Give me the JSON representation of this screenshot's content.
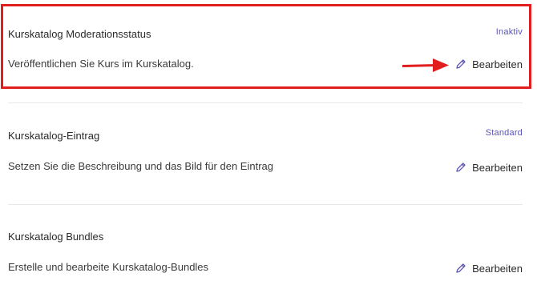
{
  "sections": [
    {
      "title": "Kurskatalog Moderationsstatus",
      "status": "Inaktiv",
      "description": "Veröffentlichen Sie Kurs im Kurskatalog.",
      "edit_label": "Bearbeiten"
    },
    {
      "title": "Kurskatalog-Eintrag",
      "status": "Standard",
      "description": "Setzen Sie die Beschreibung und das Bild für den Eintrag",
      "edit_label": "Bearbeiten"
    },
    {
      "title": "Kurskatalog Bundles",
      "description": "Erstelle und bearbeite Kurskatalog-Bundles",
      "edit_label": "Bearbeiten"
    }
  ],
  "colors": {
    "accent": "#5a54b8",
    "highlight": "#e21d1d",
    "divider": "#e8e8ec"
  },
  "icons": {
    "edit": "pencil-icon",
    "annotation": "arrow-right-icon"
  }
}
